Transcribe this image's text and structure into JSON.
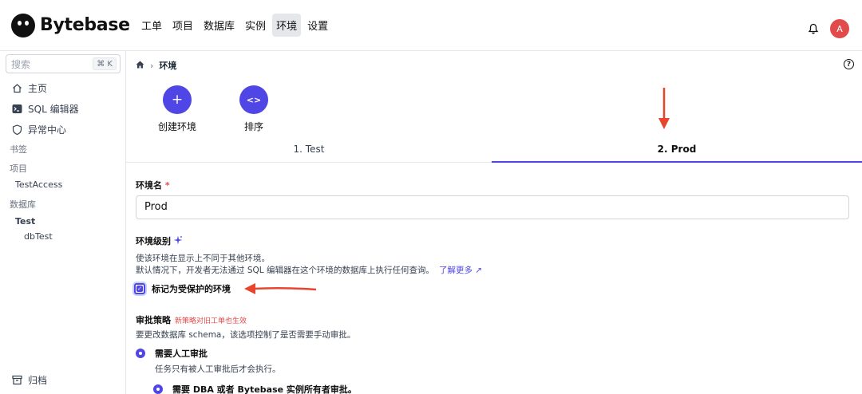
{
  "app": {
    "logo_text": "Bytebase"
  },
  "header": {
    "nav": [
      "工单",
      "项目",
      "数据库",
      "实例",
      "环境",
      "设置"
    ],
    "avatar_initial": "A"
  },
  "sidebar": {
    "search_placeholder": "搜索",
    "search_shortcut": "⌘ K",
    "items": [
      {
        "label": "主页",
        "icon": "home-icon"
      },
      {
        "label": "SQL 编辑器",
        "icon": "terminal-icon"
      },
      {
        "label": "异常中心",
        "icon": "shield-icon"
      }
    ],
    "bookmarks_label": "书签",
    "projects_label": "项目",
    "project_item": "TestAccess",
    "databases_label": "数据库",
    "db_env": "Test",
    "db_item": "dbTest",
    "archive_label": "归档"
  },
  "breadcrumb": {
    "current": "环境"
  },
  "actions": {
    "create_label": "创建环境",
    "sort_label": "排序"
  },
  "tabs": [
    "1. Test",
    "2. Prod"
  ],
  "form": {
    "name_label": "环境名",
    "required_mark": "*",
    "name_value": "Prod",
    "tier_label": "环境级别",
    "tier_desc1": "使该环境在显示上不同于其他环境。",
    "tier_desc2": "默认情况下，开发者无法通过 SQL 编辑器在这个环境的数据库上执行任何查询。",
    "learn_more": "了解更多",
    "protected_label": "标记为受保护的环境",
    "approval_label": "审批策略",
    "approval_note": "新策略对旧工单也生效",
    "approval_desc": "要更改数据库 schema，该选项控制了是否需要手动审批。",
    "manual_label": "需要人工审批",
    "manual_desc": "任务只有被人工审批后才会执行。",
    "dba_label": "需要 DBA 或者 Bytebase 实例所有者审批。"
  },
  "colors": {
    "accent": "#4f46e5",
    "danger": "#e24b4b"
  }
}
